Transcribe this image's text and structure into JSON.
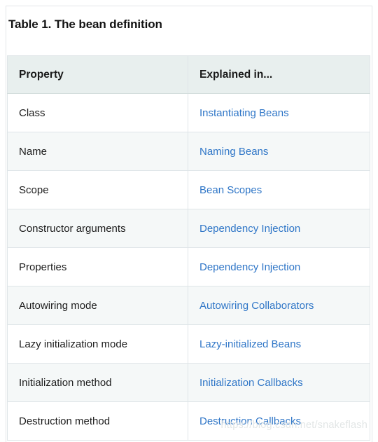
{
  "caption": "Table 1. The bean definition",
  "table": {
    "columns": [
      "Property",
      "Explained in..."
    ],
    "rows": [
      {
        "property": "Class",
        "explained_in": "Instantiating Beans"
      },
      {
        "property": "Name",
        "explained_in": "Naming Beans"
      },
      {
        "property": "Scope",
        "explained_in": "Bean Scopes"
      },
      {
        "property": "Constructor arguments",
        "explained_in": "Dependency Injection"
      },
      {
        "property": "Properties",
        "explained_in": "Dependency Injection"
      },
      {
        "property": "Autowiring mode",
        "explained_in": "Autowiring Collaborators"
      },
      {
        "property": "Lazy initialization mode",
        "explained_in": "Lazy-initialized Beans"
      },
      {
        "property": "Initialization method",
        "explained_in": "Initialization Callbacks"
      },
      {
        "property": "Destruction method",
        "explained_in": "Destruction Callbacks"
      }
    ]
  },
  "watermark": "https://blog.csdn.net/snakeflash",
  "colors": {
    "link": "#2f76c7",
    "header_background": "#e8efee",
    "alt_row_background": "#f5f8f8",
    "border": "#dfe5e8",
    "text": "#1c1c1c",
    "watermark": "#e2e6e6"
  }
}
